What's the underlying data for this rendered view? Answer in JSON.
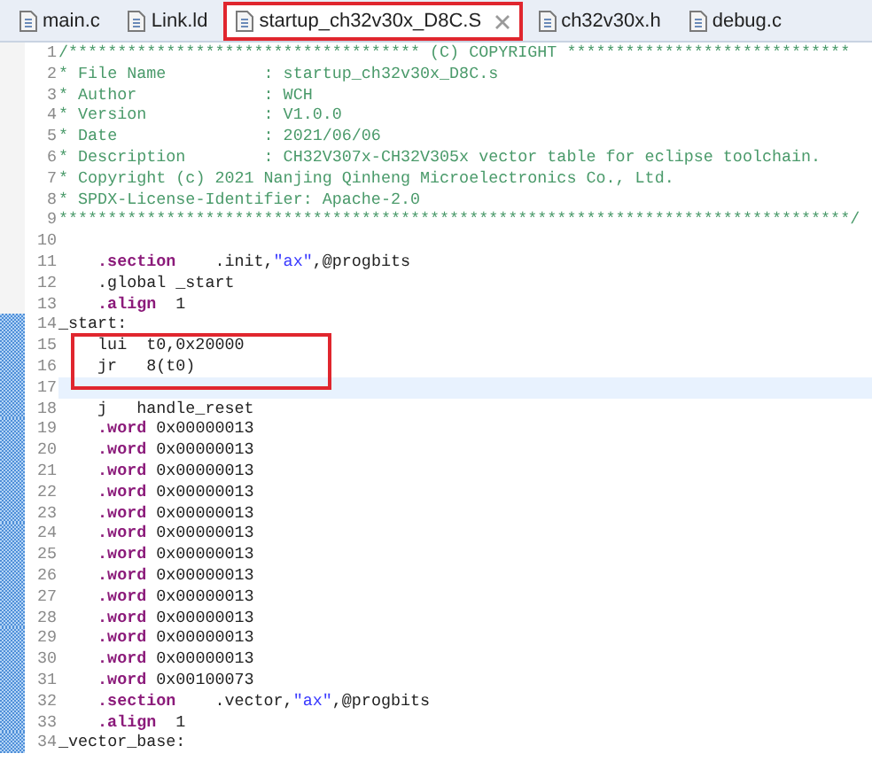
{
  "tabs": [
    {
      "label": "main.c",
      "selected": false,
      "boxed": false
    },
    {
      "label": "Link.ld",
      "selected": false,
      "boxed": false
    },
    {
      "label": "startup_ch32v30x_D8C.S",
      "selected": true,
      "boxed": true
    },
    {
      "label": "ch32v30x.h",
      "selected": false,
      "boxed": false
    },
    {
      "label": "debug.c",
      "selected": false,
      "boxed": false
    }
  ],
  "editor": {
    "lines": [
      {
        "number": "1",
        "marked": false,
        "current": false,
        "boxed": false,
        "indent": false,
        "tokens": [
          {
            "kind": "comment",
            "text": "/************************************ (C) COPYRIGHT *****************************"
          }
        ]
      },
      {
        "number": "2",
        "marked": false,
        "current": false,
        "boxed": false,
        "indent": false,
        "tokens": [
          {
            "kind": "comment",
            "text": "* File Name          : startup_ch32v30x_D8C.s"
          }
        ]
      },
      {
        "number": "3",
        "marked": false,
        "current": false,
        "boxed": false,
        "indent": false,
        "tokens": [
          {
            "kind": "comment",
            "text": "* Author             : WCH"
          }
        ]
      },
      {
        "number": "4",
        "marked": false,
        "current": false,
        "boxed": false,
        "indent": false,
        "tokens": [
          {
            "kind": "comment",
            "text": "* Version            : V1.0.0"
          }
        ]
      },
      {
        "number": "5",
        "marked": false,
        "current": false,
        "boxed": false,
        "indent": false,
        "tokens": [
          {
            "kind": "comment",
            "text": "* Date               : 2021/06/06"
          }
        ]
      },
      {
        "number": "6",
        "marked": false,
        "current": false,
        "boxed": false,
        "indent": false,
        "tokens": [
          {
            "kind": "comment",
            "text": "* Description        : CH32V307x-CH32V305x vector table for eclipse toolchain."
          }
        ]
      },
      {
        "number": "7",
        "marked": false,
        "current": false,
        "boxed": false,
        "indent": false,
        "tokens": [
          {
            "kind": "comment",
            "text": "* Copyright (c) 2021 Nanjing Qinheng Microelectronics Co., Ltd."
          }
        ]
      },
      {
        "number": "8",
        "marked": false,
        "current": false,
        "boxed": false,
        "indent": false,
        "tokens": [
          {
            "kind": "comment",
            "text": "* SPDX-License-Identifier: Apache-2.0"
          }
        ]
      },
      {
        "number": "9",
        "marked": false,
        "current": false,
        "boxed": false,
        "indent": false,
        "tokens": [
          {
            "kind": "comment",
            "text": "*********************************************************************************/"
          }
        ]
      },
      {
        "number": "10",
        "marked": false,
        "current": false,
        "boxed": false
      },
      {
        "number": "11",
        "marked": false,
        "current": false,
        "boxed": false,
        "indent": true,
        "tokens": [
          {
            "kind": "keyword",
            "text": ".section"
          },
          {
            "kind": "plain",
            "text": "    .init,"
          },
          {
            "kind": "string",
            "text": "\"ax\""
          },
          {
            "kind": "plain",
            "text": ",@progbits"
          }
        ]
      },
      {
        "number": "12",
        "marked": false,
        "current": false,
        "boxed": false,
        "indent": true,
        "tokens": [
          {
            "kind": "plain",
            "text": ".global _start"
          }
        ]
      },
      {
        "number": "13",
        "marked": false,
        "current": false,
        "boxed": false,
        "indent": true,
        "tokens": [
          {
            "kind": "keyword",
            "text": ".align"
          },
          {
            "kind": "plain",
            "text": "  1"
          }
        ]
      },
      {
        "number": "14",
        "marked": true,
        "current": false,
        "boxed": false,
        "indent": false,
        "tokens": [
          {
            "kind": "plain",
            "text": "_start:"
          }
        ]
      },
      {
        "number": "15",
        "marked": true,
        "current": false,
        "boxed": true,
        "indent": true,
        "tokens": [
          {
            "kind": "plain",
            "text": "lui  t0,0x20000"
          }
        ]
      },
      {
        "number": "16",
        "marked": true,
        "current": false,
        "boxed": true,
        "indent": true,
        "tokens": [
          {
            "kind": "plain",
            "text": "jr   8(t0)"
          }
        ]
      },
      {
        "number": "17",
        "marked": true,
        "current": true,
        "boxed": false
      },
      {
        "number": "18",
        "marked": true,
        "current": false,
        "boxed": false,
        "indent": true,
        "tokens": [
          {
            "kind": "plain",
            "text": "j   handle_reset"
          }
        ]
      },
      {
        "number": "19",
        "marked": true,
        "current": false,
        "boxed": false,
        "indent": true,
        "tokens": [
          {
            "kind": "keyword",
            "text": ".word"
          },
          {
            "kind": "plain",
            "text": " 0x00000013"
          }
        ]
      },
      {
        "number": "20",
        "marked": true,
        "current": false,
        "boxed": false,
        "indent": true,
        "tokens": [
          {
            "kind": "keyword",
            "text": ".word"
          },
          {
            "kind": "plain",
            "text": " 0x00000013"
          }
        ]
      },
      {
        "number": "21",
        "marked": true,
        "current": false,
        "boxed": false,
        "indent": true,
        "tokens": [
          {
            "kind": "keyword",
            "text": ".word"
          },
          {
            "kind": "plain",
            "text": " 0x00000013"
          }
        ]
      },
      {
        "number": "22",
        "marked": true,
        "current": false,
        "boxed": false,
        "indent": true,
        "tokens": [
          {
            "kind": "keyword",
            "text": ".word"
          },
          {
            "kind": "plain",
            "text": " 0x00000013"
          }
        ]
      },
      {
        "number": "23",
        "marked": true,
        "current": false,
        "boxed": false,
        "indent": true,
        "tokens": [
          {
            "kind": "keyword",
            "text": ".word"
          },
          {
            "kind": "plain",
            "text": " 0x00000013"
          }
        ]
      },
      {
        "number": "24",
        "marked": true,
        "current": false,
        "boxed": false,
        "indent": true,
        "tokens": [
          {
            "kind": "keyword",
            "text": ".word"
          },
          {
            "kind": "plain",
            "text": " 0x00000013"
          }
        ]
      },
      {
        "number": "25",
        "marked": true,
        "current": false,
        "boxed": false,
        "indent": true,
        "tokens": [
          {
            "kind": "keyword",
            "text": ".word"
          },
          {
            "kind": "plain",
            "text": " 0x00000013"
          }
        ]
      },
      {
        "number": "26",
        "marked": true,
        "current": false,
        "boxed": false,
        "indent": true,
        "tokens": [
          {
            "kind": "keyword",
            "text": ".word"
          },
          {
            "kind": "plain",
            "text": " 0x00000013"
          }
        ]
      },
      {
        "number": "27",
        "marked": true,
        "current": false,
        "boxed": false,
        "indent": true,
        "tokens": [
          {
            "kind": "keyword",
            "text": ".word"
          },
          {
            "kind": "plain",
            "text": " 0x00000013"
          }
        ]
      },
      {
        "number": "28",
        "marked": true,
        "current": false,
        "boxed": false,
        "indent": true,
        "tokens": [
          {
            "kind": "keyword",
            "text": ".word"
          },
          {
            "kind": "plain",
            "text": " 0x00000013"
          }
        ]
      },
      {
        "number": "29",
        "marked": true,
        "current": false,
        "boxed": false,
        "indent": true,
        "tokens": [
          {
            "kind": "keyword",
            "text": ".word"
          },
          {
            "kind": "plain",
            "text": " 0x00000013"
          }
        ]
      },
      {
        "number": "30",
        "marked": true,
        "current": false,
        "boxed": false,
        "indent": true,
        "tokens": [
          {
            "kind": "keyword",
            "text": ".word"
          },
          {
            "kind": "plain",
            "text": " 0x00000013"
          }
        ]
      },
      {
        "number": "31",
        "marked": true,
        "current": false,
        "boxed": false,
        "indent": true,
        "tokens": [
          {
            "kind": "keyword",
            "text": ".word"
          },
          {
            "kind": "plain",
            "text": " 0x00100073"
          }
        ]
      },
      {
        "number": "32",
        "marked": true,
        "current": false,
        "boxed": false,
        "indent": true,
        "tokens": [
          {
            "kind": "keyword",
            "text": ".section"
          },
          {
            "kind": "plain",
            "text": "    .vector,"
          },
          {
            "kind": "string",
            "text": "\"ax\""
          },
          {
            "kind": "plain",
            "text": ",@progbits"
          }
        ]
      },
      {
        "number": "33",
        "marked": true,
        "current": false,
        "boxed": false,
        "indent": true,
        "tokens": [
          {
            "kind": "keyword",
            "text": ".align"
          },
          {
            "kind": "plain",
            "text": "  1"
          }
        ]
      },
      {
        "number": "34",
        "marked": true,
        "current": false,
        "boxed": false,
        "indent": false,
        "tokens": [
          {
            "kind": "plain",
            "text": "_vector_base:"
          }
        ]
      }
    ]
  }
}
